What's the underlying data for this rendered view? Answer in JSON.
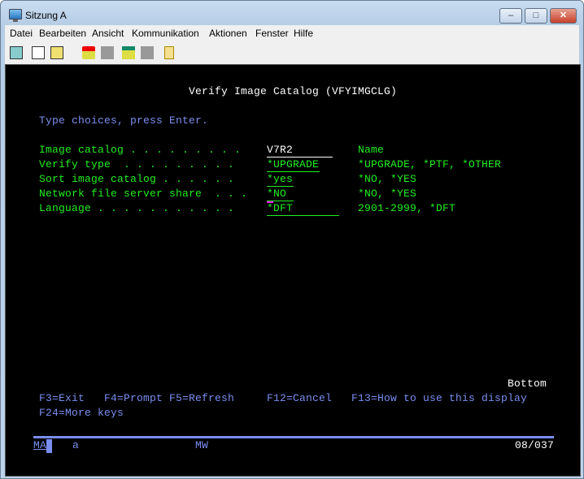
{
  "window": {
    "title": "Sitzung A",
    "minimize": "–",
    "maximize": "□",
    "close": "✕"
  },
  "menu": [
    "Datei",
    "Bearbeiten",
    "Ansicht",
    "Kommunikation",
    "Aktionen",
    "Fenster",
    "Hilfe"
  ],
  "toolbar": [
    "copy-screen-icon",
    "copy-icon",
    "paste-icon",
    "record-macro-icon",
    "stop-macro-icon",
    "play-macro-icon",
    "pause-macro-icon",
    "notepad-icon"
  ],
  "screen": {
    "title": "Verify Image Catalog (VFYIMGCLG)",
    "instructions": "Type choices, press Enter.",
    "fields": [
      {
        "label": "Image catalog . . . . . . . . .",
        "value": "V7R2",
        "hint": "Name"
      },
      {
        "label": "Verify type  . . . . . . . . .",
        "value": "*UPGRADE",
        "hint": "*UPGRADE, *PTF, *OTHER"
      },
      {
        "label": "Sort image catalog . . . . . .",
        "value": "*yes",
        "hint": "*NO, *YES"
      },
      {
        "label": "Network file server share  . . .",
        "value": "*NO",
        "hint": "*NO, *YES"
      },
      {
        "label": "Language . . . . . . . . . . .",
        "value": "*DFT",
        "hint": "2901-2999, *DFT"
      }
    ],
    "bottom": "Bottom",
    "fkeys": [
      "F3=Exit",
      "F4=Prompt",
      "F5=Refresh",
      "F12=Cancel",
      "F13=How to use this display"
    ],
    "fkeys2": "F24=More keys"
  },
  "status": {
    "mode": "MA",
    "indicator": "a",
    "mw": "MW",
    "cursor": "08/037"
  }
}
